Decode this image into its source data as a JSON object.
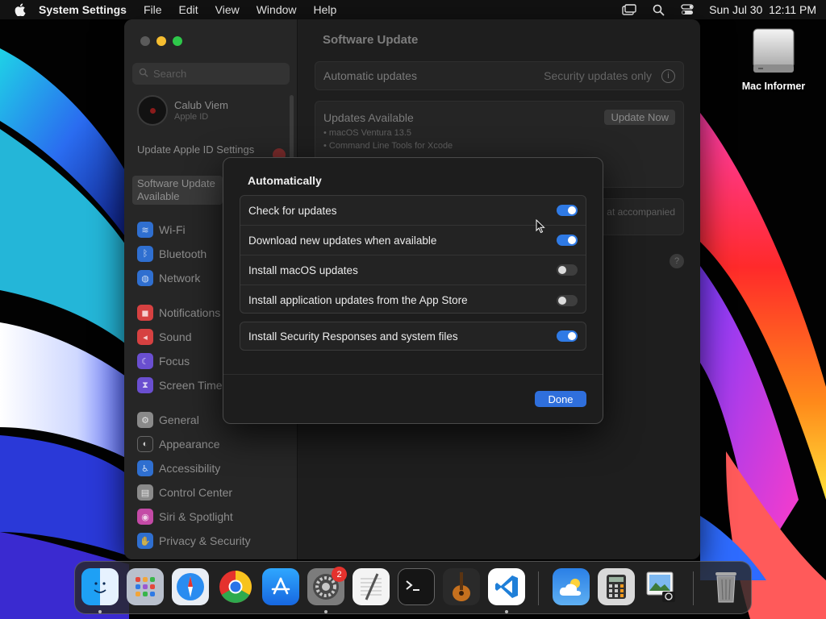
{
  "menubar": {
    "app_name": "System Settings",
    "items": [
      "File",
      "Edit",
      "View",
      "Window",
      "Help"
    ],
    "clock": "Sun Jul 30  12:11 PM"
  },
  "desktop": {
    "disk_label": "Mac Informer"
  },
  "window": {
    "search_placeholder": "Search",
    "account": {
      "name": "Calub Viem",
      "sub": "Apple ID"
    },
    "notice": "Update Apple ID Settings",
    "selected": "Software Update Available",
    "sidebar": [
      {
        "label": "Wi-Fi",
        "color": "#2f6fd0",
        "icon": "wifi-icon"
      },
      {
        "label": "Bluetooth",
        "color": "#2f6fd0",
        "icon": "bluetooth-icon"
      },
      {
        "label": "Network",
        "color": "#2f6fd0",
        "icon": "network-icon"
      },
      {
        "label": "Notifications",
        "color": "#d64141",
        "icon": "notifications-icon"
      },
      {
        "label": "Sound",
        "color": "#d64141",
        "icon": "sound-icon"
      },
      {
        "label": "Focus",
        "color": "#6a4fd0",
        "icon": "focus-icon"
      },
      {
        "label": "Screen Time",
        "color": "#6a4fd0",
        "icon": "screen-time-icon"
      },
      {
        "label": "General",
        "color": "#8a8a8a",
        "icon": "general-icon"
      },
      {
        "label": "Appearance",
        "color": "#2a2a2a",
        "icon": "appearance-icon"
      },
      {
        "label": "Accessibility",
        "color": "#2f6fd0",
        "icon": "accessibility-icon"
      },
      {
        "label": "Control Center",
        "color": "#8a8a8a",
        "icon": "control-center-icon"
      },
      {
        "label": "Siri & Spotlight",
        "color": "#c44aa6",
        "icon": "siri-icon"
      },
      {
        "label": "Privacy & Security",
        "color": "#2f6fd0",
        "icon": "privacy-icon"
      }
    ],
    "content": {
      "title": "Software Update",
      "auto_label": "Automatic updates",
      "auto_value": "Security updates only",
      "updates_title": "Updates Available",
      "update_button": "Update Now",
      "update_lines": [
        "• macOS Ventura 13.5",
        "• Command Line Tools for Xcode"
      ],
      "note_fragment": "at accompanied"
    }
  },
  "sheet": {
    "heading": "Automatically",
    "rows": [
      {
        "label": "Check for updates",
        "on": true
      },
      {
        "label": "Download new updates when available",
        "on": true
      },
      {
        "label": "Install macOS updates",
        "on": false
      },
      {
        "label": "Install application updates from the App Store",
        "on": false
      }
    ],
    "security_row": {
      "label": "Install Security Responses and system files",
      "on": true
    },
    "done_label": "Done"
  },
  "dock": {
    "apps": [
      "Finder",
      "Launchpad",
      "Safari",
      "Chrome",
      "App Store",
      "System Settings",
      "TextEdit",
      "Terminal",
      "GarageBand",
      "VS Code",
      "Weather",
      "Calculator",
      "Preview",
      "Trash"
    ],
    "settings_badge": "2"
  },
  "colors": {
    "accent": "#2f7ae5",
    "done": "#2f6fdc",
    "badge": "#e5322d"
  }
}
